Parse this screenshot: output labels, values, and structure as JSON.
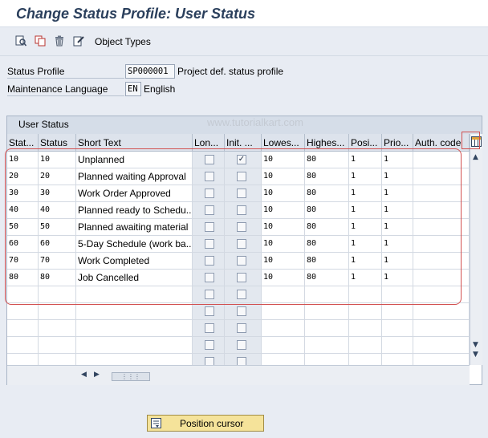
{
  "window": {
    "title": "Change Status Profile: User Status"
  },
  "toolbar": {
    "icons": [
      "display-change-icon",
      "copy-icon",
      "delete-icon",
      "edit-icon"
    ],
    "object_types_label": "Object Types"
  },
  "header": {
    "status_profile": {
      "label": "Status Profile",
      "value": "SP000001",
      "description": "Project def. status profile"
    },
    "maintenance_language": {
      "label": "Maintenance Language",
      "value": "EN",
      "description": "English"
    }
  },
  "user_status": {
    "group_title": "User Status",
    "watermark": "www.tutorialkart.com",
    "columns": [
      "Stat...",
      "Status",
      "Short Text",
      "Lon...",
      "Init. ...",
      "Lowes...",
      "Highes...",
      "Posi...",
      "Prio...",
      "Auth. code"
    ],
    "rows": [
      {
        "stat": "10",
        "status": "10",
        "short_text": "Unplanned",
        "long_text": false,
        "initial": true,
        "lowest": "10",
        "highest": "80",
        "position": "1",
        "priority": "1",
        "auth_code": ""
      },
      {
        "stat": "20",
        "status": "20",
        "short_text": "Planned waiting Approval",
        "long_text": false,
        "initial": false,
        "lowest": "10",
        "highest": "80",
        "position": "1",
        "priority": "1",
        "auth_code": ""
      },
      {
        "stat": "30",
        "status": "30",
        "short_text": "Work Order Approved",
        "long_text": false,
        "initial": false,
        "lowest": "10",
        "highest": "80",
        "position": "1",
        "priority": "1",
        "auth_code": ""
      },
      {
        "stat": "40",
        "status": "40",
        "short_text": "Planned ready to Schedu...",
        "long_text": false,
        "initial": false,
        "lowest": "10",
        "highest": "80",
        "position": "1",
        "priority": "1",
        "auth_code": ""
      },
      {
        "stat": "50",
        "status": "50",
        "short_text": "Planned awaiting material",
        "long_text": false,
        "initial": false,
        "lowest": "10",
        "highest": "80",
        "position": "1",
        "priority": "1",
        "auth_code": ""
      },
      {
        "stat": "60",
        "status": "60",
        "short_text": "5-Day Schedule (work ba...",
        "long_text": false,
        "initial": false,
        "lowest": "10",
        "highest": "80",
        "position": "1",
        "priority": "1",
        "auth_code": ""
      },
      {
        "stat": "70",
        "status": "70",
        "short_text": "Work Completed",
        "long_text": false,
        "initial": false,
        "lowest": "10",
        "highest": "80",
        "position": "1",
        "priority": "1",
        "auth_code": ""
      },
      {
        "stat": "80",
        "status": "80",
        "short_text": "Job Cancelled",
        "long_text": false,
        "initial": false,
        "lowest": "10",
        "highest": "80",
        "position": "1",
        "priority": "1",
        "auth_code": ""
      }
    ],
    "empty_rows": 5
  },
  "footer": {
    "position_cursor_label": "Position cursor"
  },
  "colors": {
    "title": "#2a3f5c",
    "annotation": "#d25050",
    "button": "#f5e39a"
  }
}
